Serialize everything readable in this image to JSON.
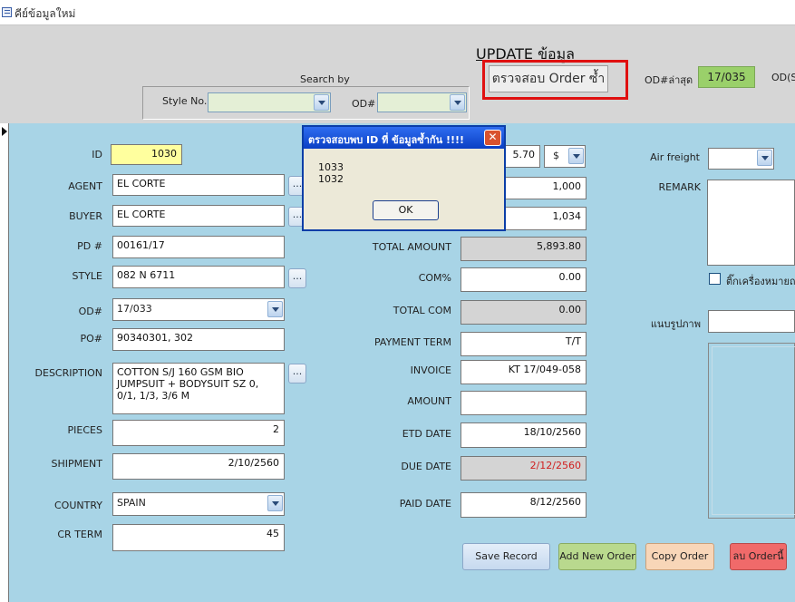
{
  "window": {
    "title": "คีย์ข้อมูลใหม่"
  },
  "header": {
    "page_title": "UPDATE ข้อมูล",
    "search_by_label": "Search by",
    "style_no_label": "Style No.",
    "style_no_value": "",
    "od_label": "OD#",
    "od_value": "",
    "check_duplicate_button": "ตรวจสอบ Order ซ้ำ",
    "od_last_label": "OD#ล่าสุด",
    "od_last_value": "17/035",
    "od_s_label": "OD(S"
  },
  "form_left": {
    "id_label": "ID",
    "id_value": "1030",
    "agent_label": "AGENT",
    "agent_value": "EL CORTE",
    "buyer_label": "BUYER",
    "buyer_value": "EL CORTE",
    "pd_label": "PD #",
    "pd_value": "00161/17",
    "style_label": "STYLE",
    "style_value": "082 N 6711",
    "od_label": "OD#",
    "od_value": "17/033",
    "po_label": "PO#",
    "po_value": "90340301, 302",
    "description_label": "DESCRIPTION",
    "description_value": "COTTON S/J 160 GSM BIO\nJUMPSUIT + BODYSUIT SZ 0,\n0/1, 1/3, 3/6 M",
    "pieces_label": "PIECES",
    "pieces_value": "2",
    "shipment_label": "SHIPMENT",
    "shipment_value": "2/10/2560",
    "country_label": "COUNTRY",
    "country_value": "SPAIN",
    "cr_term_label": "CR TERM",
    "cr_term_value": "45",
    "dots_label": "..."
  },
  "form_mid": {
    "price_value": "5.70",
    "currency_value": "$",
    "qty_value": "1,000",
    "qty2_value": "1,034",
    "total_amount_label": "TOTAL AMOUNT",
    "total_amount_value": "5,893.80",
    "com_label": "COM%",
    "com_value": "0.00",
    "total_com_label": "TOTAL COM",
    "total_com_value": "0.00",
    "payment_term_label": "PAYMENT TERM",
    "payment_term_value": "T/T",
    "invoice_label": "INVOICE",
    "invoice_value": "KT 17/049-058",
    "amount_label": "AMOUNT",
    "amount_value": "",
    "etd_date_label": "ETD DATE",
    "etd_date_value": "18/10/2560",
    "due_date_label": "DUE DATE",
    "due_date_value": "2/12/2560",
    "paid_date_label": "PAID DATE",
    "paid_date_value": "8/12/2560"
  },
  "form_right": {
    "air_freight_label": "Air freight",
    "air_freight_value": "",
    "remark_label": "REMARK",
    "remark_value": "",
    "checkbox_label": "ติ๊กเครื่องหมายถ",
    "attach_image_label": "แนบรูปภาพ",
    "attach_image_value": ""
  },
  "buttons": {
    "save_record": "Save Record",
    "add_new_order": "Add New Order",
    "copy_order": "Copy Order",
    "delete_order": "ลบ Orderนี้"
  },
  "dialog": {
    "title": "ตรวจสอบพบ ID ที่ ข้อมูลซ้ำกัน !!!!",
    "close_symbol": "✕",
    "message": "1033\n1032",
    "ok_label": "OK"
  },
  "colors": {
    "form_background": "#a8d4e6",
    "header_background": "#d6d6d6",
    "highlight_red": "#e01010",
    "od_last_green": "#9ad06a",
    "id_yellow": "#ffff9e",
    "save_button": "#cfe0f3",
    "add_button": "#b9d98e",
    "copy_button": "#f8d6b8",
    "delete_button": "#f06a6a"
  }
}
